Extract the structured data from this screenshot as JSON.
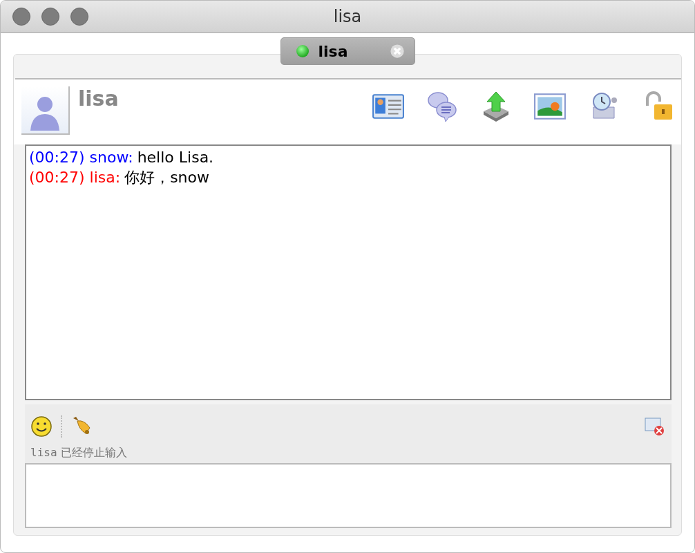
{
  "window": {
    "title": "lisa"
  },
  "tabs": [
    {
      "label": "lisa",
      "selected": true,
      "online": true
    }
  ],
  "contact": {
    "name": "lisa"
  },
  "messages": [
    {
      "time": "(00:27)",
      "sender": "snow:",
      "text": "hello Lisa.",
      "color": "#0000ff"
    },
    {
      "time": "(00:27)",
      "sender": "lisa:",
      "text": "你好，snow",
      "color": "#ff0000"
    }
  ],
  "typing_status": {
    "user": "lisa",
    "text": "已经停止输入"
  }
}
